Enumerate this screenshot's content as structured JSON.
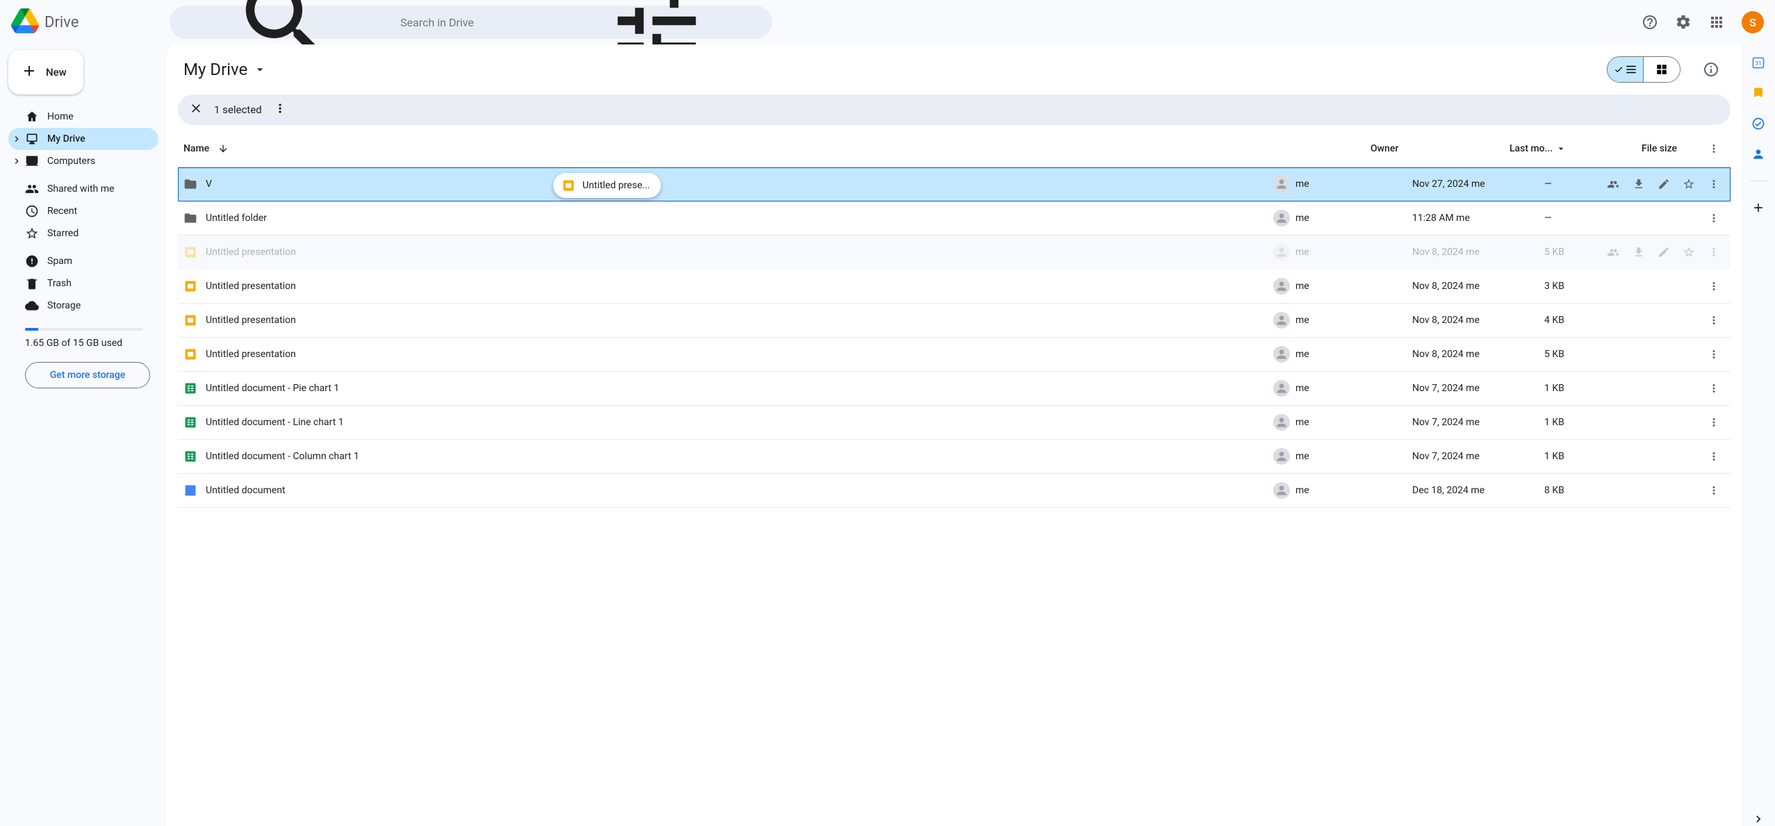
{
  "app_name": "Drive",
  "search": {
    "placeholder": "Search in Drive"
  },
  "avatar_initial": "S",
  "new_button": "New",
  "nav": {
    "home": "Home",
    "my_drive": "My Drive",
    "computers": "Computers",
    "shared": "Shared with me",
    "recent": "Recent",
    "starred": "Starred",
    "spam": "Spam",
    "trash": "Trash",
    "storage": "Storage"
  },
  "storage_text": "1.65 GB of 15 GB used",
  "get_storage": "Get more storage",
  "breadcrumb": "My Drive",
  "selection_count": "1 selected",
  "columns": {
    "name": "Name",
    "owner": "Owner",
    "modified": "Last mo...",
    "size": "File size"
  },
  "drag_label": "Untitled prese...",
  "rows": [
    {
      "name": "V",
      "type": "folder",
      "owner": "me",
      "modified": "Nov 27, 2024 me",
      "size": "—",
      "selected": true,
      "show_actions": true
    },
    {
      "name": "Untitled folder",
      "type": "folder",
      "owner": "me",
      "modified": "11:28 AM me",
      "size": "—"
    },
    {
      "name": "Untitled presentation",
      "type": "slides",
      "owner": "me",
      "modified": "Nov 8, 2024 me",
      "size": "5 KB",
      "ghost": true,
      "show_actions": true
    },
    {
      "name": "Untitled presentation",
      "type": "slides",
      "owner": "me",
      "modified": "Nov 8, 2024 me",
      "size": "3 KB"
    },
    {
      "name": "Untitled presentation",
      "type": "slides",
      "owner": "me",
      "modified": "Nov 8, 2024 me",
      "size": "4 KB"
    },
    {
      "name": "Untitled presentation",
      "type": "slides",
      "owner": "me",
      "modified": "Nov 8, 2024 me",
      "size": "5 KB"
    },
    {
      "name": "Untitled document - Pie chart 1",
      "type": "sheets",
      "owner": "me",
      "modified": "Nov 7, 2024 me",
      "size": "1 KB"
    },
    {
      "name": "Untitled document - Line chart 1",
      "type": "sheets",
      "owner": "me",
      "modified": "Nov 7, 2024 me",
      "size": "1 KB"
    },
    {
      "name": "Untitled document - Column chart 1",
      "type": "sheets",
      "owner": "me",
      "modified": "Nov 7, 2024 me",
      "size": "1 KB"
    },
    {
      "name": "Untitled document",
      "type": "docs",
      "owner": "me",
      "modified": "Dec 18, 2024 me",
      "size": "8 KB"
    }
  ]
}
